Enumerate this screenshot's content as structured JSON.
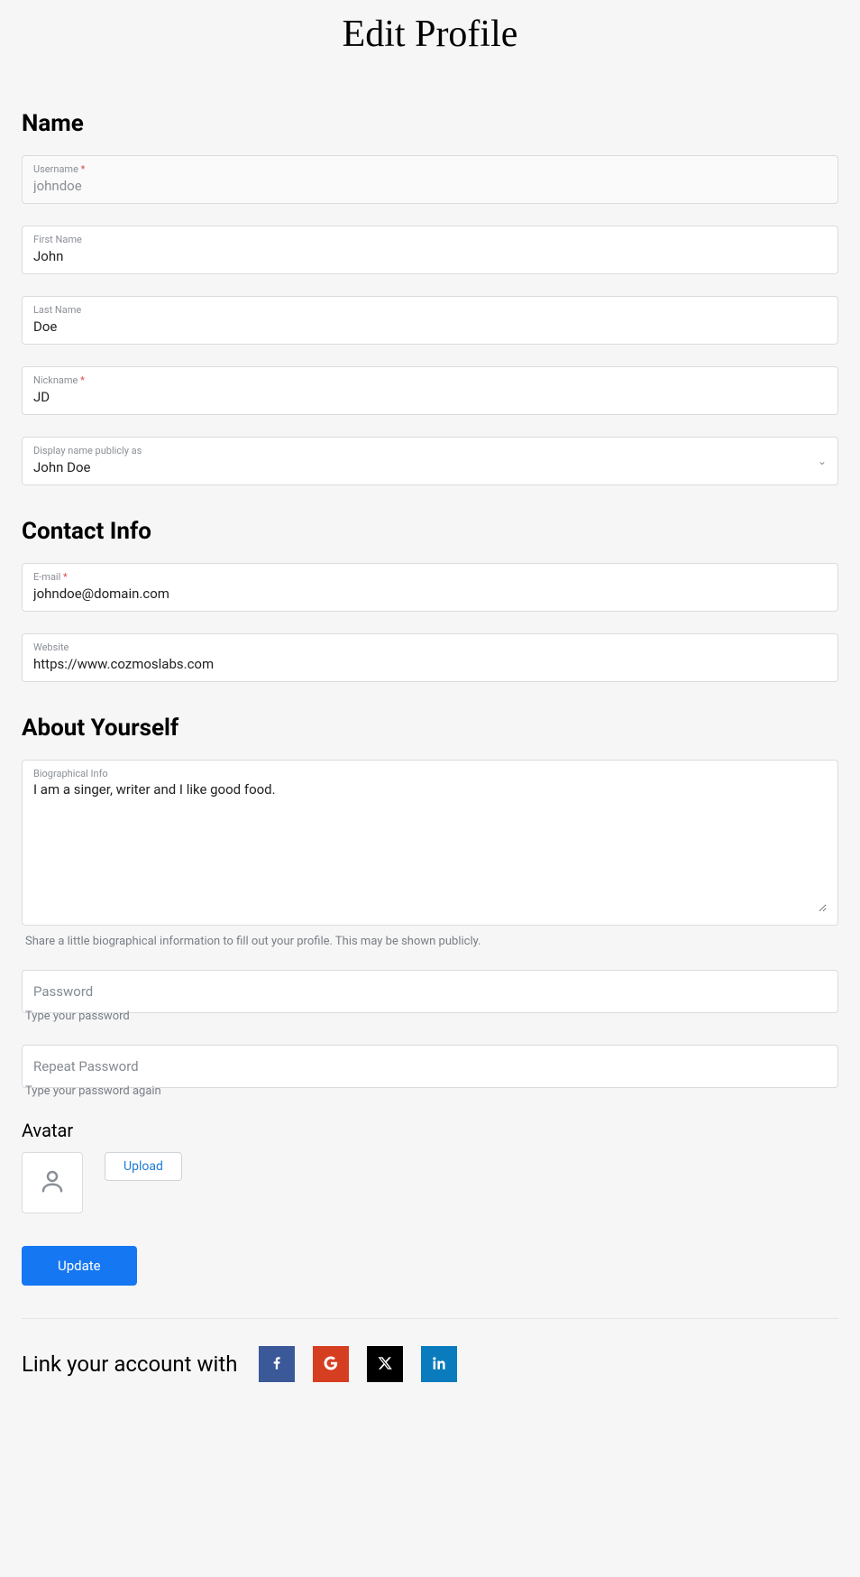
{
  "page": {
    "title": "Edit Profile"
  },
  "sections": {
    "name": {
      "heading": "Name",
      "username": {
        "label": "Username",
        "required": "*",
        "value": "johndoe"
      },
      "first_name": {
        "label": "First Name",
        "value": "John"
      },
      "last_name": {
        "label": "Last Name",
        "value": "Doe"
      },
      "nickname": {
        "label": "Nickname",
        "required": "*",
        "value": "JD"
      },
      "display_name": {
        "label": "Display name publicly as",
        "value": "John Doe"
      }
    },
    "contact": {
      "heading": "Contact Info",
      "email": {
        "label": "E-mail",
        "required": "*",
        "value": "johndoe@domain.com"
      },
      "website": {
        "label": "Website",
        "value": "https://www.cozmoslabs.com"
      }
    },
    "about": {
      "heading": "About Yourself",
      "bio": {
        "label": "Biographical Info",
        "value": "I am a singer, writer and I like good food.",
        "help": "Share a little biographical information to fill out your profile. This may be shown publicly."
      },
      "password": {
        "placeholder": "Password",
        "help": "Type your password"
      },
      "repeat_password": {
        "placeholder": "Repeat Password",
        "help": "Type your password again"
      }
    },
    "avatar": {
      "heading": "Avatar",
      "upload": "Upload"
    }
  },
  "actions": {
    "update": "Update"
  },
  "social": {
    "heading": "Link your account with",
    "providers": {
      "facebook": "facebook",
      "google": "google",
      "x": "x",
      "linkedin": "linkedin"
    }
  }
}
